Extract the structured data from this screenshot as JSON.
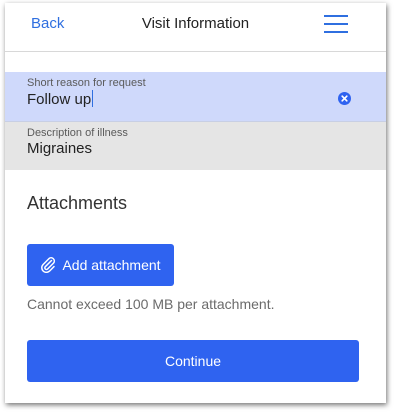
{
  "header": {
    "back_label": "Back",
    "title": "Visit Information",
    "menu_icon": "hamburger-menu-icon"
  },
  "form": {
    "reason": {
      "label": "Short reason for request",
      "value": "Follow up",
      "clear_icon": "clear-x-circle-icon"
    },
    "description": {
      "label": "Description of illness",
      "value": "Migraines"
    }
  },
  "attachments": {
    "title": "Attachments",
    "add_label": "Add attachment",
    "add_icon": "paperclip-icon",
    "limit_hint": "Cannot exceed 100 MB per attachment."
  },
  "footer": {
    "continue_label": "Continue"
  },
  "colors": {
    "accent": "#2f63f0",
    "link": "#2f6fe0",
    "active_field_bg": "#cfd9fb",
    "disabled_field_bg": "#e5e5e5"
  }
}
